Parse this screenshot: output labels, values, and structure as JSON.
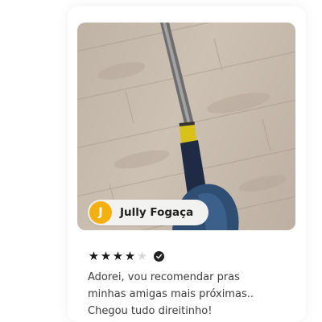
{
  "review": {
    "author_initial": "J",
    "author_name": "Jully Fogaça",
    "rating": 4,
    "rating_max": 5,
    "verified_icon": "check-circle-icon",
    "text": "Adorei, vou recomendar pras minhas amigas mais próximas.. Chegou tudo direitinho!",
    "colors": {
      "avatar_bg": "#f3b00f",
      "star_on": "#1a1a1a",
      "star_off": "#d8d8d8"
    }
  }
}
